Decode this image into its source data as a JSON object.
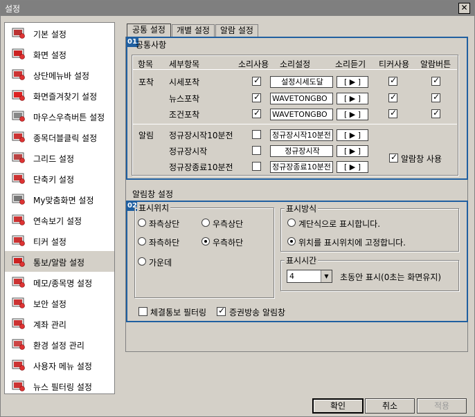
{
  "window": {
    "title": "설정",
    "close_glyph": "✕"
  },
  "sidebar": {
    "items": [
      {
        "label": "기본 설정",
        "icon": "monitor-settings-icon"
      },
      {
        "label": "화면 설정",
        "icon": "screen-icon"
      },
      {
        "label": "상단메뉴바 설정",
        "icon": "menubar-icon"
      },
      {
        "label": "화면즐겨찾기 설정",
        "icon": "star-icon"
      },
      {
        "label": "마우스우측버튼 설정",
        "icon": "mouse-icon"
      },
      {
        "label": "종목더블클릭 설정",
        "icon": "cursor-icon"
      },
      {
        "label": "그리드 설정",
        "icon": "grid-icon"
      },
      {
        "label": "단축키 설정",
        "icon": "hotkey-icon"
      },
      {
        "label": "My맞춤화면 설정",
        "icon": "custom-screen-icon"
      },
      {
        "label": "연속보기 설정",
        "icon": "magnifier-icon"
      },
      {
        "label": "티커 설정",
        "icon": "ticker-icon"
      },
      {
        "label": "통보/알람 설정",
        "icon": "alarm-icon"
      },
      {
        "label": "메모/종목명 설정",
        "icon": "memo-icon"
      },
      {
        "label": "보안 설정",
        "icon": "shield-icon"
      },
      {
        "label": "계좌 관리",
        "icon": "account-icon"
      },
      {
        "label": "환경 설정 관리",
        "icon": "gear-icon"
      },
      {
        "label": "사용자 메뉴 설정",
        "icon": "user-menu-icon"
      },
      {
        "label": "뉴스 필터링 설정",
        "icon": "news-icon"
      }
    ],
    "selected_index": 11
  },
  "tabs": [
    {
      "label": "공통 설정",
      "active": true
    },
    {
      "label": "개별 설정",
      "active": false
    },
    {
      "label": "알람 설정",
      "active": false
    }
  ],
  "common": {
    "badge": "01",
    "title": "공통사항",
    "headers": [
      "항목",
      "세부항목",
      "소리사용",
      "소리설정",
      "소리듣기",
      "티커사용",
      "알람버튼"
    ],
    "play_label": "[ ▶ ]",
    "groups": [
      {
        "name": "포착",
        "rows": [
          {
            "item": "시세포착",
            "sound": true,
            "file": "설정시세도달",
            "ticker": true,
            "alarm": true
          },
          {
            "item": "뉴스포착",
            "sound": true,
            "file": "WAVETONGBO",
            "ticker": true,
            "alarm": true
          },
          {
            "item": "조건포착",
            "sound": true,
            "file": "WAVETONGBO",
            "ticker": true,
            "alarm": true
          }
        ]
      },
      {
        "name": "알림",
        "rows": [
          {
            "item": "정규장시작10분전",
            "sound": false,
            "file": "정규장시작10분전"
          },
          {
            "item": "정규장시작",
            "sound": false,
            "file": "정규장시작"
          },
          {
            "item": "정규장종료10분전",
            "sound": false,
            "file": "정규장종료10분전"
          }
        ]
      }
    ],
    "alarm_window_use": {
      "label": "알람창 사용",
      "checked": true
    }
  },
  "alarm_window": {
    "section_label": "알림창 설정",
    "badge": "02",
    "position": {
      "title": "표시위치",
      "options": [
        {
          "label": "좌측상단",
          "checked": false
        },
        {
          "label": "우측상단",
          "checked": false
        },
        {
          "label": "좌측하단",
          "checked": false
        },
        {
          "label": "우측하단",
          "checked": true
        },
        {
          "label": "가운데",
          "checked": false
        }
      ]
    },
    "method": {
      "title": "표시방식",
      "options": [
        {
          "label": "계단식으로 표시합니다.",
          "checked": false
        },
        {
          "label": "위치를 표시위치에 고정합니다.",
          "checked": true
        }
      ]
    },
    "duration": {
      "title": "표시시간",
      "value": "4",
      "suffix": "초동안 표시(0초는 화면유지)"
    },
    "filter_checks": [
      {
        "label": "체결통보 필터링",
        "checked": false
      },
      {
        "label": "증권방송 알림창",
        "checked": true
      }
    ]
  },
  "footer": {
    "ok": "확인",
    "cancel": "취소",
    "apply": "적용"
  }
}
